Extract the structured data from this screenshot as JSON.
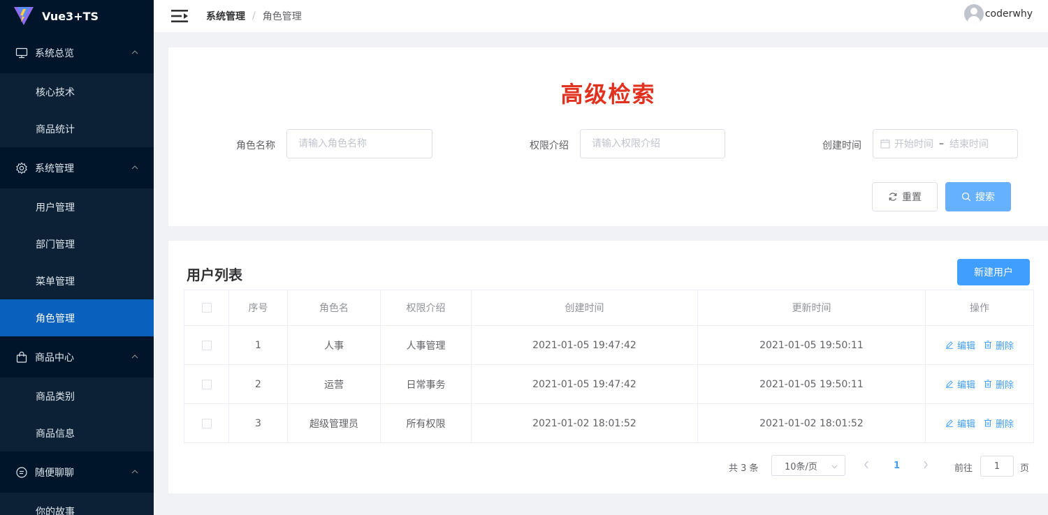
{
  "app": {
    "title": "Vue3+TS"
  },
  "menu": [
    {
      "title": "系统总览",
      "icon": "monitor-icon",
      "items": [
        "核心技术",
        "商品统计"
      ]
    },
    {
      "title": "系统管理",
      "icon": "gear-icon",
      "items": [
        "用户管理",
        "部门管理",
        "菜单管理",
        "角色管理"
      ]
    },
    {
      "title": "商品中心",
      "icon": "shopping-bag-icon",
      "items": [
        "商品类别",
        "商品信息"
      ]
    },
    {
      "title": "随便聊聊",
      "icon": "chat-icon",
      "items": [
        "你的故事"
      ]
    }
  ],
  "active_item": "角色管理",
  "header": {
    "breadcrumb": [
      "系统管理",
      "角色管理"
    ],
    "username": "coderwhy"
  },
  "search": {
    "title": "高级检索",
    "fields": [
      {
        "label": "角色名称",
        "placeholder": "请输入角色名称"
      },
      {
        "label": "权限介绍",
        "placeholder": "请输入权限介绍"
      },
      {
        "label": "创建时间",
        "start_placeholder": "开始时间",
        "separator": "–",
        "end_placeholder": "结束时间"
      }
    ],
    "reset_label": "重置",
    "search_label": "搜索"
  },
  "table": {
    "title": "用户列表",
    "new_button": "新建用户",
    "columns": [
      "序号",
      "角色名",
      "权限介绍",
      "创建时间",
      "更新时间",
      "操作"
    ],
    "rows": [
      {
        "index": "1",
        "name": "人事",
        "intro": "人事管理",
        "created": "2021-01-05 19:47:42",
        "updated": "2021-01-05 19:50:11"
      },
      {
        "index": "2",
        "name": "运营",
        "intro": "日常事务",
        "created": "2021-01-05 19:47:42",
        "updated": "2021-01-05 19:50:11"
      },
      {
        "index": "3",
        "name": "超级管理员",
        "intro": "所有权限",
        "created": "2021-01-02 18:01:52",
        "updated": "2021-01-02 18:01:52"
      }
    ],
    "edit_label": "编辑",
    "delete_label": "删除"
  },
  "pagination": {
    "total": "共 3 条",
    "page_size": "10条/页",
    "current_page": "1",
    "goto_label": "前往",
    "goto_value": "1",
    "page_unit": "页"
  },
  "colors": {
    "sidebar_bg": "#001529",
    "active_item": "#0a60bd",
    "primary": "#409eff",
    "title_red": "#e0321e"
  }
}
